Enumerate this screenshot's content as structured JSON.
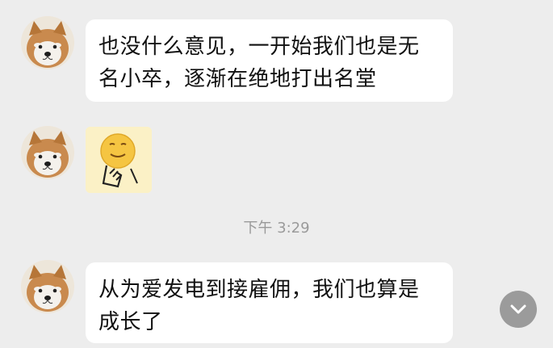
{
  "messages": [
    {
      "type": "text",
      "lines": [
        "也没什么意见，一开始我们也是无",
        "名小卒，逐渐在绝地打出名堂"
      ]
    },
    {
      "type": "sticker",
      "sticker_icon": "thinking-smiley-sticker-icon"
    },
    {
      "type": "text",
      "lines": [
        "从为爱发电到接雇佣，我们也算是",
        "成长了"
      ]
    }
  ],
  "timestamp": "下午 3:29",
  "avatar_icon": "shiba-dog-avatar-icon",
  "scroll_icon": "chevron-down-icon",
  "colors": {
    "background": "#ededed",
    "bubble": "#ffffff",
    "text": "#111111",
    "timestamp": "#9a9a9a",
    "scroll_button": "#9b9b9b"
  }
}
